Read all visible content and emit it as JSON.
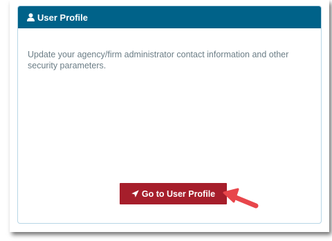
{
  "card": {
    "title": "User Profile",
    "title_icon": "user-icon",
    "description": "Update your agency/firm administrator contact information and other security parameters."
  },
  "button": {
    "label": "Go to User Profile",
    "icon": "rocket-icon"
  },
  "colors": {
    "header": "#006289",
    "button": "#a61e2b",
    "annotation_arrow": "#e8464b"
  }
}
